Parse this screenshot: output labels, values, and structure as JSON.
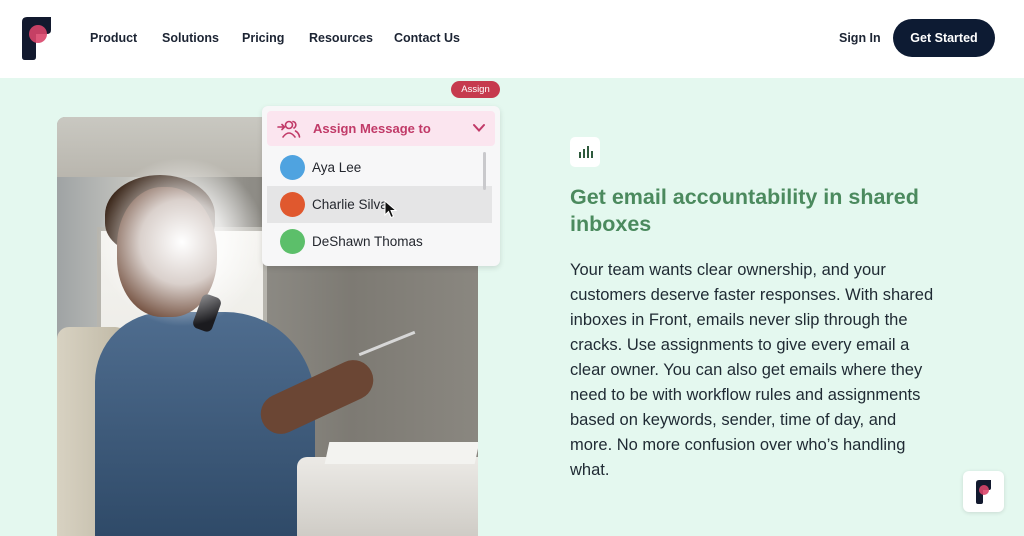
{
  "header": {
    "logo_name": "Front",
    "nav": [
      {
        "label": "Product"
      },
      {
        "label": "Solutions"
      },
      {
        "label": "Pricing"
      },
      {
        "label": "Resources"
      },
      {
        "label": "Contact Us"
      }
    ],
    "sign_in_label": "Sign In",
    "cta_label": "Get Started"
  },
  "illustration": {
    "badge_label": "Assign",
    "dropdown": {
      "title": "Assign Message to",
      "icon": "assign-users-icon",
      "items": [
        {
          "name": "Aya Lee",
          "avatar_color": "#4fa3e0"
        },
        {
          "name": "Charlie Silva",
          "avatar_color": "#e0582e",
          "hovered": true
        },
        {
          "name": "DeShawn Thomas",
          "avatar_color": "#5cbf6a"
        }
      ]
    }
  },
  "feature": {
    "icon": "bar-chart-icon",
    "headline": "Get email accountability in shared inboxes",
    "body": "Your team wants clear ownership, and your customers deserve faster responses. With shared inboxes in Front, emails never slip through the cracks. Use assignments to give every email a clear owner. You can also get emails where they need to be with workflow rules and assignments based on keywords, sender, time of day, and more. No more confusion over who’s handling what."
  },
  "colors": {
    "brand_navy": "#0d1b33",
    "brand_pink": "#d9456a",
    "headline_green": "#4b8a5e",
    "page_background": "#e4f8ef"
  }
}
